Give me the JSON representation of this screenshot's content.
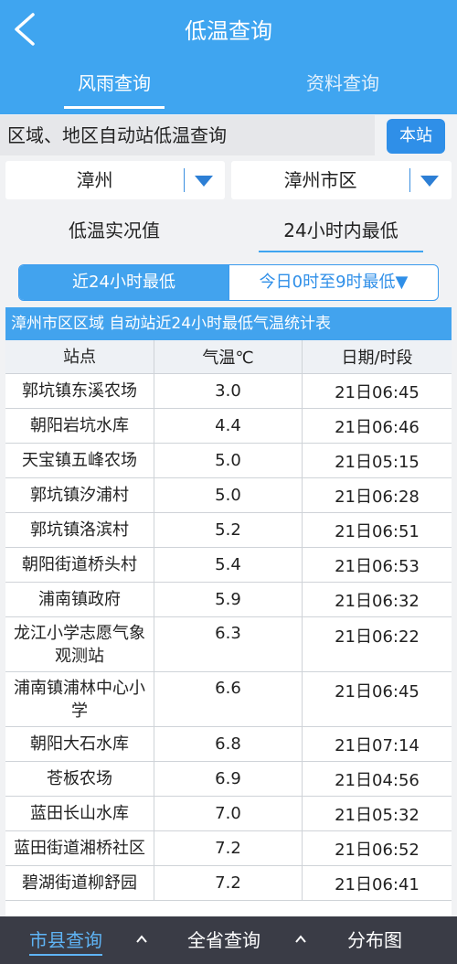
{
  "header": {
    "title": "低温查询"
  },
  "tabs": [
    {
      "label": "风雨查询",
      "active": true
    },
    {
      "label": "资料查询",
      "active": false
    }
  ],
  "region": {
    "label": "区域、地区自动站低温查询",
    "button": "本站"
  },
  "selects": {
    "city": "漳州",
    "district": "漳州市区"
  },
  "modes": {
    "current": "低温实况值",
    "min24": "24小时内最低"
  },
  "segments": {
    "a": "近24小时最低",
    "b": "今日0时至9时最低▼"
  },
  "table": {
    "title": "漳州市区区域 自动站近24小时最低气温统计表",
    "headers": [
      "站点",
      "气温℃",
      "日期/时段"
    ],
    "rows": [
      [
        "郭坑镇东溪农场",
        "3.0",
        "21日06:45"
      ],
      [
        "朝阳岩坑水库",
        "4.4",
        "21日06:46"
      ],
      [
        "天宝镇五峰农场",
        "5.0",
        "21日05:15"
      ],
      [
        "郭坑镇汐浦村",
        "5.0",
        "21日06:28"
      ],
      [
        "郭坑镇洛滨村",
        "5.2",
        "21日06:51"
      ],
      [
        "朝阳街道桥头村",
        "5.4",
        "21日06:53"
      ],
      [
        "浦南镇政府",
        "5.9",
        "21日06:32"
      ],
      [
        "龙江小学志愿气象观测站",
        "6.3",
        "21日06:22"
      ],
      [
        "浦南镇浦林中心小学",
        "6.6",
        "21日06:45"
      ],
      [
        "朝阳大石水库",
        "6.8",
        "21日07:14"
      ],
      [
        "苍板农场",
        "6.9",
        "21日04:56"
      ],
      [
        "蓝田长山水库",
        "7.0",
        "21日05:32"
      ],
      [
        "蓝田街道湘桥社区",
        "7.2",
        "21日06:52"
      ],
      [
        "碧湖街道柳舒园",
        "7.2",
        "21日06:41"
      ]
    ]
  },
  "bottom_nav": [
    "市县查询",
    "全省查询",
    "分布图"
  ],
  "colors": {
    "primary": "#3fa5f0",
    "button": "#2f8fe8",
    "bottom_bar": "#3a3c46"
  }
}
